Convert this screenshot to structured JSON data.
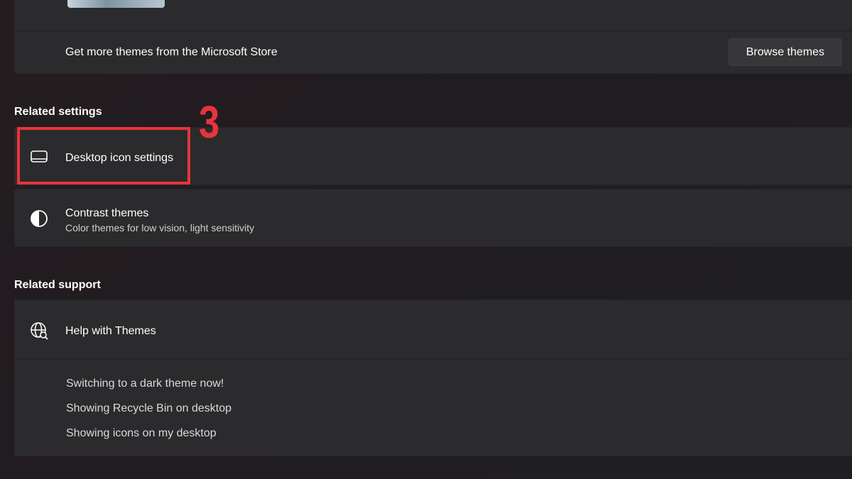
{
  "themes": {
    "store_label": "Get more themes from the Microsoft Store",
    "browse_button": "Browse themes"
  },
  "related_settings": {
    "header": "Related settings",
    "items": [
      {
        "label": "Desktop icon settings",
        "icon": "monitor-icon"
      },
      {
        "label": "Contrast themes",
        "sublabel": "Color themes for low vision, light sensitivity",
        "icon": "contrast-icon"
      }
    ]
  },
  "related_support": {
    "header": "Related support",
    "help": {
      "label": "Help with Themes",
      "icon": "globe-icon"
    },
    "links": [
      "Switching to a dark theme now!",
      "Showing Recycle Bin on desktop",
      "Showing icons on my desktop"
    ]
  },
  "annotation": {
    "step": "3",
    "color": "#e8343a"
  },
  "colors": {
    "card_bg": "#2b2b2d",
    "page_bg": "#211d20",
    "accent_red": "#e8343a"
  }
}
